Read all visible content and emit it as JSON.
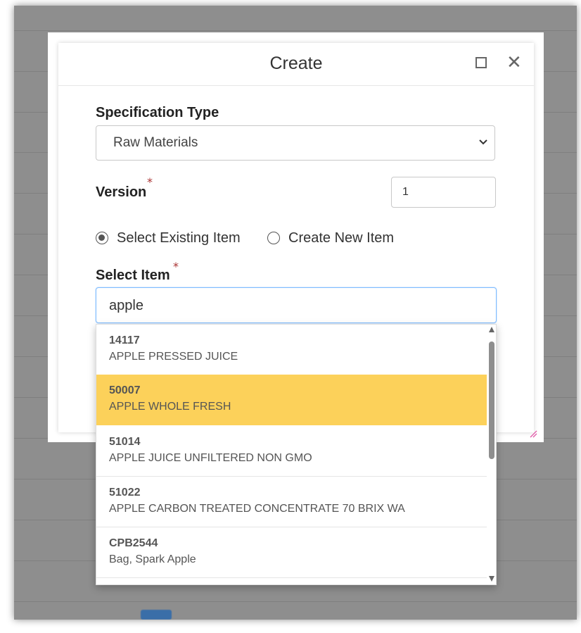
{
  "modal": {
    "title": "Create",
    "maximize_icon": "maximize-icon",
    "close_icon": "close-icon"
  },
  "form": {
    "spec_type_label": "Specification Type",
    "spec_type_value": "Raw Materials",
    "version_label": "Version",
    "version_value": "1",
    "required_mark": "*",
    "radio_existing_label": "Select Existing Item",
    "radio_new_label": "Create New Item",
    "radio_selected": "existing",
    "select_item_label": "Select Item",
    "search_value": "apple"
  },
  "results": [
    {
      "code": "14117",
      "name": "APPLE PRESSED JUICE",
      "highlighted": false
    },
    {
      "code": "50007",
      "name": "APPLE WHOLE FRESH",
      "highlighted": true
    },
    {
      "code": "51014",
      "name": "APPLE JUICE UNFILTERED NON GMO",
      "highlighted": false
    },
    {
      "code": "51022",
      "name": "APPLE CARBON TREATED CONCENTRATE 70 BRIX WA",
      "highlighted": false
    },
    {
      "code": "CPB2544",
      "name": "Bag, Spark Apple",
      "highlighted": false
    }
  ],
  "colors": {
    "highlight": "#fcd15a",
    "focus_border": "#80bdff",
    "required": "#aa3333",
    "backdrop": "#8e8e8e"
  }
}
